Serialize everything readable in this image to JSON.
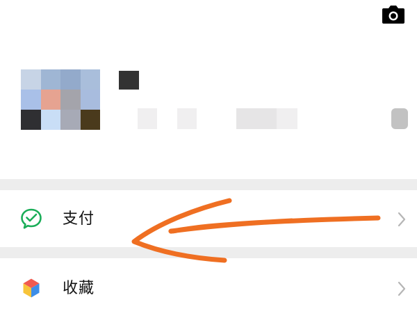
{
  "profile": {
    "avatar_colors": [
      "#c7d4e6",
      "#9fb6d4",
      "#93aacb",
      "#a9bedb",
      "#a9c0e8",
      "#e6a391",
      "#a4a4ab",
      "#a8bcde",
      "#2f2f32",
      "#c9def6",
      "#a7aab6",
      "#4a3a1c"
    ]
  },
  "menu": {
    "items": [
      {
        "label": "支付",
        "icon": "pay-icon"
      },
      {
        "label": "收藏",
        "icon": "favorites-icon"
      }
    ]
  },
  "colors": {
    "annotation_stroke": "#ef6f22",
    "pay_icon": "#1aad58",
    "divider": "#ededed",
    "chevron": "#b5b5b5"
  }
}
